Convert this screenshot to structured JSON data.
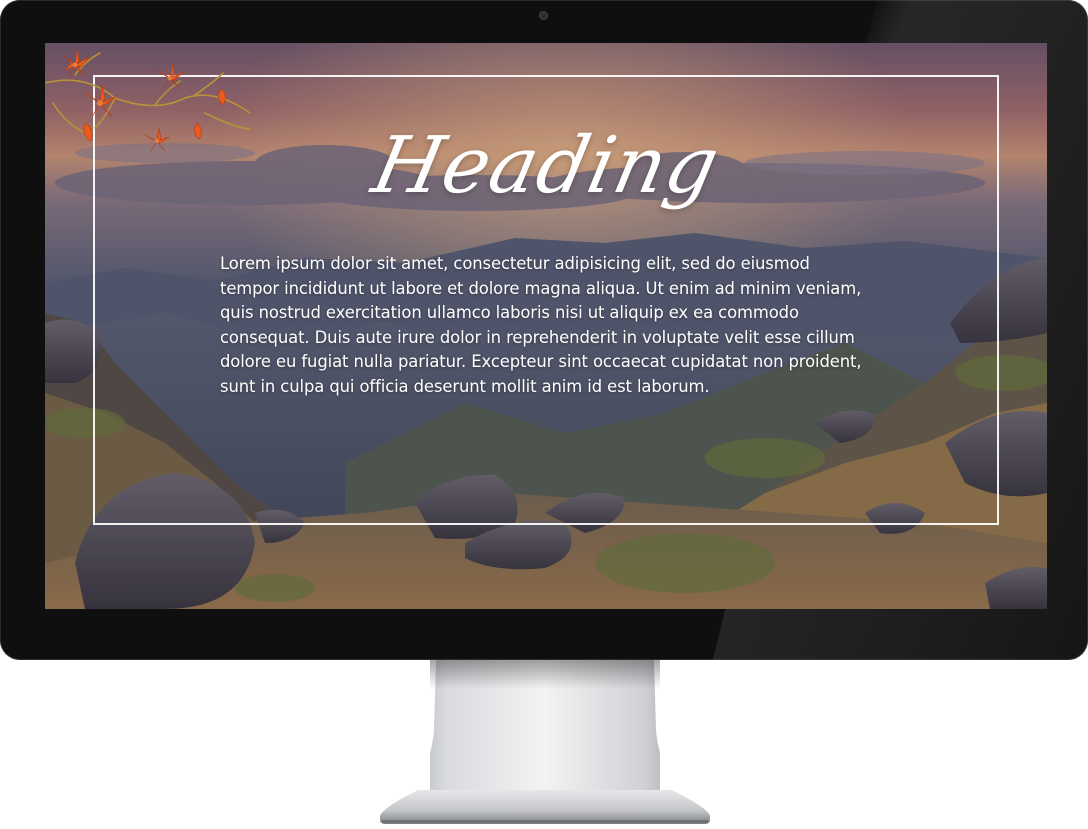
{
  "slide": {
    "heading": "Heading",
    "body": "Lorem ipsum dolor sit amet, consectetur adipisicing elit, sed do eiusmod tempor incididunt ut labore et dolore magna aliqua. Ut enim ad minim veniam, quis nostrud exercitation ullamco laboris nisi ut aliquip ex ea commodo consequat. Duis aute irure dolor in reprehenderit in voluptate velit esse cillum dolore eu fugiat nulla pariatur. Excepteur sint occaecat cupidatat non proident, sunt in culpa qui officia deserunt mollit anim id est laborum."
  },
  "icons": {
    "ornament": "autumn-leaves-branch-icon",
    "camera": "webcam-icon"
  },
  "colors": {
    "bezel": "#0f0f10",
    "text": "#ffffff",
    "leaf": "#e8531c",
    "sky_top": "#6e5a72",
    "sky_glow": "#d99a74"
  }
}
